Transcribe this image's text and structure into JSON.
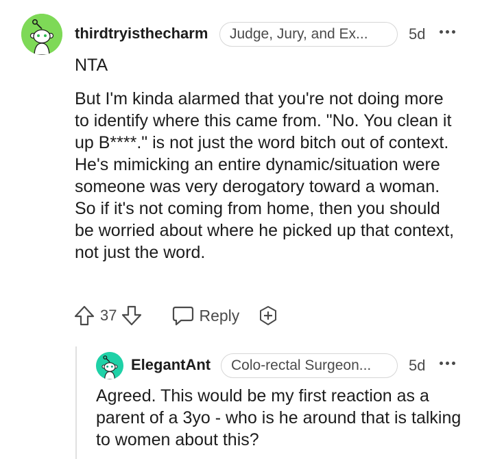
{
  "comments": {
    "parent": {
      "username": "thirdtryisthecharm",
      "flair": "Judge, Jury, and Ex...",
      "time": "5d",
      "first_line": "NTA",
      "body": "But I'm kinda alarmed that you're not doing more to identify where this came from. \"No. You clean it up B****.\" is not just the word bitch out of context. He's mimicking an entire dynamic/situation were someone was very derogatory toward a woman. So if it's not coming from home, then you should be worried about where he picked up that context, not just the word.",
      "votes": "37",
      "reply_label": "Reply",
      "avatar_color": "#7ed957"
    },
    "reply": {
      "username": "ElegantAnt",
      "flair": "Colo-rectal Surgeon...",
      "time": "5d",
      "body": "Agreed. This would be my first reaction as a parent of a 3yo - who is he around that is talking to women about this?",
      "avatar_color": "#1fd1a7"
    }
  },
  "icons": {
    "upvote": "upvote-arrow-icon",
    "downvote": "downvote-arrow-icon",
    "reply": "speech-bubble-icon",
    "award": "award-plus-icon",
    "more": "more-dots-icon",
    "avatar": "snoo-avatar-icon"
  }
}
